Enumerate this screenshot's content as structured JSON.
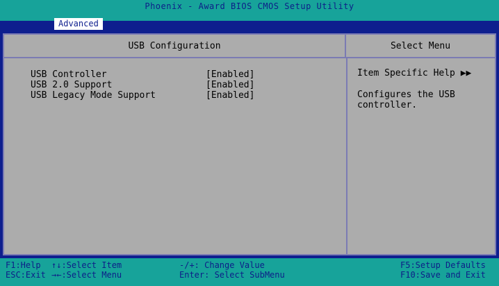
{
  "header": {
    "title": "Phoenix - Award BIOS CMOS Setup Utility",
    "active_tab": "Advanced"
  },
  "main": {
    "section_title": "USB Configuration",
    "items": [
      {
        "label": "USB Controller",
        "value": "[Enabled]"
      },
      {
        "label": "USB 2.0 Support",
        "value": "[Enabled]"
      },
      {
        "label": "USB Legacy Mode Support",
        "value": "[Enabled]"
      }
    ]
  },
  "help": {
    "section_title": "Select Menu",
    "title": "Item Specific Help ▶▶",
    "text": "Configures the USB controller."
  },
  "footer": {
    "f1": "F1:Help",
    "esc": "ESC:Exit",
    "select_item": "↑↓:Select Item",
    "select_menu": "→←:Select Menu",
    "change_value": "-/+: Change Value",
    "enter": "Enter: Select SubMenu",
    "f5": "F5:Setup Defaults",
    "f10": "F10:Save and Exit"
  },
  "colors": {
    "background": "#0e1f8e",
    "title_bar": "#17a39a",
    "panel": "#acacac",
    "border": "#7b7bb3"
  }
}
